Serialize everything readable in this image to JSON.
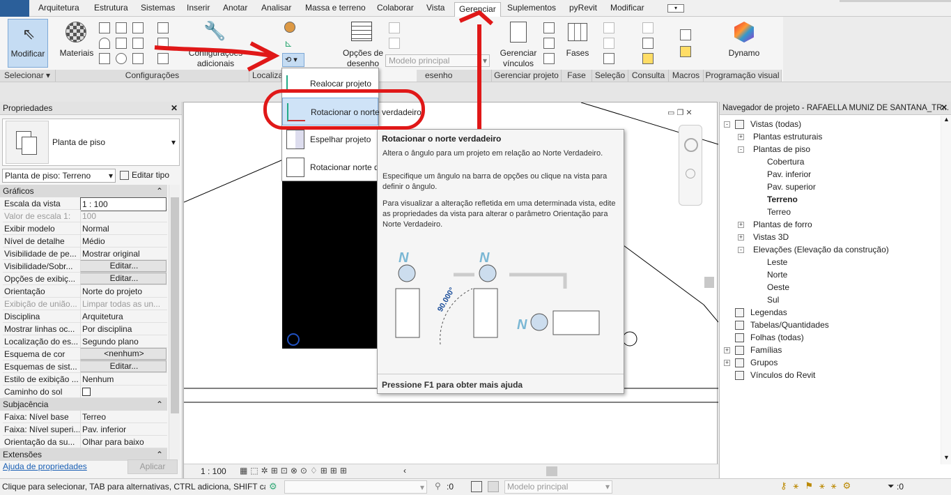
{
  "tabs": [
    "Arquitetura",
    "Estrutura",
    "Sistemas",
    "Inserir",
    "Anotar",
    "Analisar",
    "Massa e terreno",
    "Colaborar",
    "Vista",
    "Gerenciar",
    "Suplementos",
    "pyRevit",
    "Modificar"
  ],
  "active_tab": "Gerenciar",
  "ribbon": {
    "modify_label": "Modificar",
    "materials_label": "Materiais",
    "additional_settings_label": "Configurações adicionais",
    "design_options_label1": "Opções de",
    "design_options_label2": "desenho",
    "main_model_select": "Modelo principal",
    "manage_links_label1": "Gerenciar",
    "manage_links_label2": "vínculos",
    "phases_label": "Fases",
    "dynamo_label": "Dynamo",
    "panels": {
      "select": "Selecionar",
      "settings": "Configurações",
      "location": "Localiza",
      "design_options": "esenho",
      "manage_project": "Gerenciar projeto",
      "phase": "Fase",
      "selection": "Seleção",
      "inquiry": "Consulta",
      "macros": "Macros",
      "visual_programming": "Programação visual"
    }
  },
  "menu": {
    "items": [
      "Realocar projeto",
      "Rotacionar o norte verdadeiro",
      "Espelhar projeto",
      "Rotacionar norte d"
    ]
  },
  "tooltip": {
    "title": "Rotacionar o norte verdadeiro",
    "p1": "Altera o ângulo para um projeto em relação ao Norte Verdadeiro.",
    "p2": "Especifique um ângulo na barra de opções ou clique na vista para definir o ângulo.",
    "p3": "Para visualizar a alteração refletida em uma determinada vista, edite as propriedades da vista para alterar o parâmetro Orientação para Norte Verdadeiro.",
    "angle": "90.000°",
    "footer": "Pressione F1 para obter mais ajuda",
    "n_label": "N"
  },
  "properties": {
    "title": "Propriedades",
    "type_name": "Planta de piso",
    "instance_select": "Planta de piso: Terreno",
    "edit_type": "Editar tipo",
    "section_graphics": "Gráficos",
    "rows": [
      {
        "k": "Escala da vista",
        "v": "1 : 100",
        "style": "input"
      },
      {
        "k": "Valor de escala    1:",
        "v": "100",
        "style": "dis"
      },
      {
        "k": "Exibir modelo",
        "v": "Normal",
        "style": ""
      },
      {
        "k": "Nível de detalhe",
        "v": "Médio",
        "style": ""
      },
      {
        "k": "Visibilidade de pe...",
        "v": "Mostrar original",
        "style": ""
      },
      {
        "k": "Visibilidade/Sobr...",
        "v": "Editar...",
        "style": "btn"
      },
      {
        "k": "Opções de exibiç...",
        "v": "Editar...",
        "style": "btn"
      },
      {
        "k": "Orientação",
        "v": "Norte do projeto",
        "style": ""
      },
      {
        "k": "Exibição de união...",
        "v": "Limpar todas as un...",
        "style": "dis"
      },
      {
        "k": "Disciplina",
        "v": "Arquitetura",
        "style": ""
      },
      {
        "k": "Mostrar linhas oc...",
        "v": "Por disciplina",
        "style": ""
      },
      {
        "k": "Localização do es...",
        "v": "Segundo plano",
        "style": ""
      },
      {
        "k": "Esquema de cor",
        "v": "<nenhum>",
        "style": "btn"
      },
      {
        "k": "Esquemas de sist...",
        "v": "Editar...",
        "style": "btn"
      },
      {
        "k": "Estilo de exibição ...",
        "v": "Nenhum",
        "style": ""
      },
      {
        "k": "Caminho do sol",
        "v": "",
        "style": "check"
      }
    ],
    "section_underlay": "Subjacência",
    "rows2": [
      {
        "k": "Faixa: Nível base",
        "v": "Terreo"
      },
      {
        "k": "Faixa: Nível superi...",
        "v": "Pav. inferior"
      },
      {
        "k": "Orientação da su...",
        "v": "Olhar para baixo"
      }
    ],
    "section_extents": "Extensões",
    "help_link": "Ajuda de propriedades",
    "apply": "Aplicar"
  },
  "canvas": {
    "scale": "1 : 100"
  },
  "navigator": {
    "title": "Navegador de projeto - RAFAELLA MUNIZ DE SANTANA_TR...",
    "items": [
      {
        "label": "Vistas (todas)",
        "level": 0,
        "tog": "-",
        "icon": true
      },
      {
        "label": "Plantas estruturais",
        "level": 1,
        "tog": "+"
      },
      {
        "label": "Plantas de piso",
        "level": 1,
        "tog": "-"
      },
      {
        "label": "Cobertura",
        "level": 2
      },
      {
        "label": "Pav. inferior",
        "level": 2
      },
      {
        "label": "Pav. superior",
        "level": 2
      },
      {
        "label": "Terreno",
        "level": 2,
        "bold": true
      },
      {
        "label": "Terreo",
        "level": 2
      },
      {
        "label": "Plantas de forro",
        "level": 1,
        "tog": "+"
      },
      {
        "label": "Vistas 3D",
        "level": 1,
        "tog": "+"
      },
      {
        "label": "Elevações (Elevação da construção)",
        "level": 1,
        "tog": "-"
      },
      {
        "label": "Leste",
        "level": 2
      },
      {
        "label": "Norte",
        "level": 2
      },
      {
        "label": "Oeste",
        "level": 2
      },
      {
        "label": "Sul",
        "level": 2
      },
      {
        "label": "Legendas",
        "level": 0,
        "icon": true
      },
      {
        "label": "Tabelas/Quantidades",
        "level": 0,
        "icon": true
      },
      {
        "label": "Folhas (todas)",
        "level": 0,
        "icon": true
      },
      {
        "label": "Famílias",
        "level": 0,
        "tog": "+",
        "icon": true
      },
      {
        "label": "Grupos",
        "level": 0,
        "tog": "+",
        "icon": true
      },
      {
        "label": "Vínculos do Revit",
        "level": 0,
        "icon": true
      }
    ]
  },
  "status": {
    "message": "Clique para selecionar, TAB para alternativas, CTRL adiciona, SHIFT canc",
    "count": ":0",
    "model": "Modelo principal",
    "filter_count": ":0"
  },
  "colors": {
    "annotation_red": "#e01818",
    "accent_blue": "#2b5f9a"
  }
}
